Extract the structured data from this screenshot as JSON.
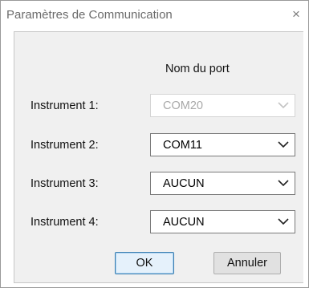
{
  "window": {
    "title": "Paramètres de Communication",
    "close_glyph": "×"
  },
  "table": {
    "column_header": "Nom du port"
  },
  "rows": [
    {
      "label": "Instrument 1:",
      "value": "COM20",
      "enabled": false
    },
    {
      "label": "Instrument 2:",
      "value": "COM11",
      "enabled": true
    },
    {
      "label": "Instrument 3:",
      "value": "AUCUN",
      "enabled": true
    },
    {
      "label": "Instrument 4:",
      "value": "AUCUN",
      "enabled": true
    }
  ],
  "buttons": {
    "ok": "OK",
    "cancel": "Annuler"
  },
  "icons": {
    "close": "close-icon",
    "dropdown": "chevron-down-icon"
  },
  "colors": {
    "ok_border": "#3c7fb1",
    "ok_fill": "#e5f1fb",
    "panel_bg": "#f0f0f0",
    "disabled_text": "#a8a8a8"
  }
}
